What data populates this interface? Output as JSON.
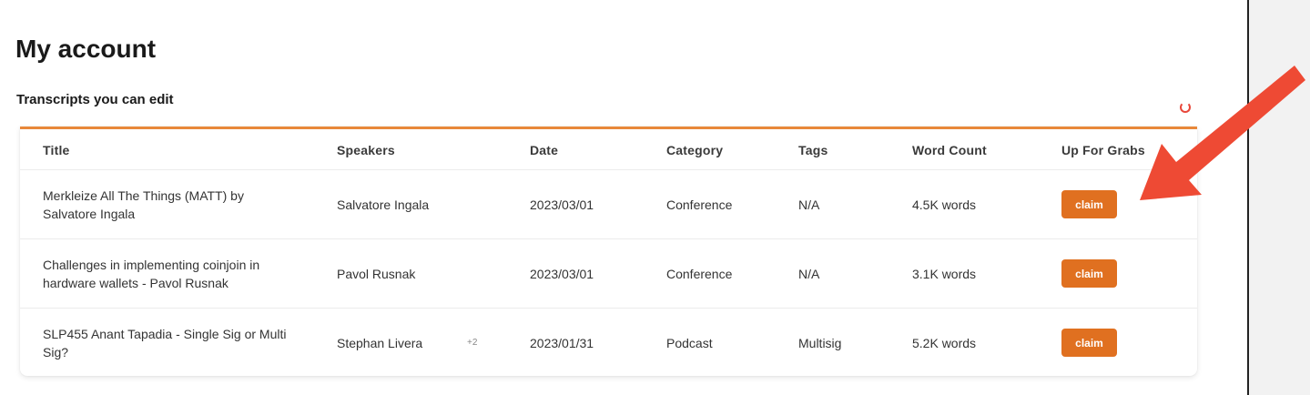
{
  "page": {
    "title": "My account",
    "section_title": "Transcripts you can edit"
  },
  "table": {
    "columns": [
      "Title",
      "Speakers",
      "Date",
      "Category",
      "Tags",
      "Word Count",
      "Up For Grabs"
    ],
    "rows": [
      {
        "title": "Merkleize All The Things (MATT) by Salvatore Ingala",
        "speakers": "Salvatore Ingala",
        "more_speakers": "",
        "date": "2023/03/01",
        "category": "Conference",
        "tags": "N/A",
        "word_count": "4.5K words",
        "action": "claim"
      },
      {
        "title": "Challenges in implementing coinjoin in hardware wallets - Pavol Rusnak",
        "speakers": "Pavol Rusnak",
        "more_speakers": "",
        "date": "2023/03/01",
        "category": "Conference",
        "tags": "N/A",
        "word_count": "3.1K words",
        "action": "claim"
      },
      {
        "title": "SLP455 Anant Tapadia - Single Sig or Multi Sig?",
        "speakers": "Stephan Livera",
        "more_speakers": "+2",
        "date": "2023/01/31",
        "category": "Podcast",
        "tags": "Multisig",
        "word_count": "5.2K words",
        "action": "claim"
      }
    ]
  },
  "colors": {
    "accent": "#e8883a",
    "button": "#e07020",
    "annotation_arrow": "#e8473a"
  },
  "icons": {
    "refresh": "refresh-icon",
    "annotation": "arrow-annotation"
  }
}
